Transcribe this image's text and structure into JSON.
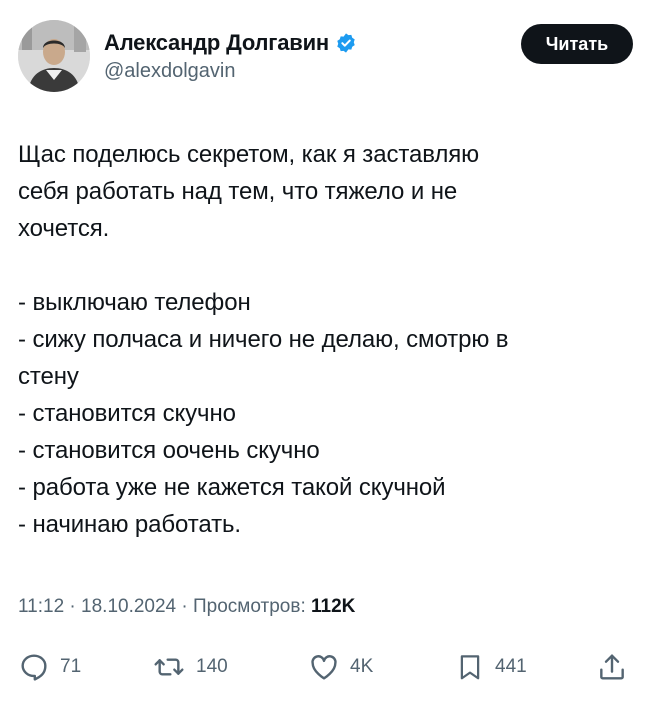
{
  "author": {
    "name": "Александр Долгавин",
    "handle": "@alexdolgavin",
    "verified": true,
    "follow_label": "Читать"
  },
  "tweet": {
    "paragraph1": [
      "Щас поделюсь секретом, как я заставляю",
      "себя работать над тем, что тяжело и не",
      "хочется."
    ],
    "list": [
      "- выключаю телефон",
      "- сижу полчаса и ничего не делаю, смотрю в",
      "стену",
      "- становится скучно",
      "- становится оочень скучно",
      "- работа уже не кажется такой скучной",
      "- начинаю работать."
    ]
  },
  "meta": {
    "time": "11:12",
    "date": "18.10.2024",
    "views_label": "Просмотров:",
    "views_count": "112K",
    "separator": "·"
  },
  "actions": {
    "replies": "71",
    "reposts": "140",
    "likes": "4K",
    "bookmarks": "441"
  },
  "colors": {
    "verified_badge": "#1d9bf0",
    "secondary_text": "#536471",
    "primary_text": "#0f1419"
  }
}
